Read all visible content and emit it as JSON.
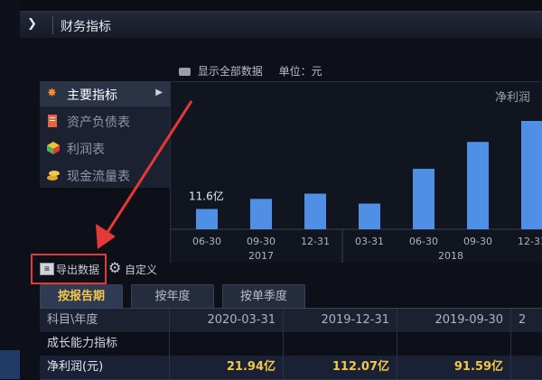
{
  "window": {
    "title": "财务指标"
  },
  "toolbar": {
    "show_all_label": "显示全部数据",
    "unit_label": "单位：元"
  },
  "menu": {
    "items": [
      {
        "label": "主要指标",
        "active": true
      },
      {
        "label": "资产负债表",
        "active": false
      },
      {
        "label": "利润表",
        "active": false
      },
      {
        "label": "现金流量表",
        "active": false
      }
    ]
  },
  "chart_data": {
    "type": "bar",
    "title": "净利润",
    "categories": [
      "06-30",
      "09-30",
      "12-31",
      "03-31",
      "06-30",
      "09-30",
      "12-31"
    ],
    "year_labels": [
      "2017",
      "2018"
    ],
    "values": [
      11.6,
      17.4,
      20.4,
      14.7,
      34.6,
      50.0,
      62.0
    ],
    "annotation": "11.6亿",
    "series_color": "#4f8fe6"
  },
  "actions": {
    "export_label": "导出数据",
    "custom_label": "自定义"
  },
  "tabs": [
    {
      "label": "按报告期",
      "active": true
    },
    {
      "label": "按年度",
      "active": false
    },
    {
      "label": "按单季度",
      "active": false
    }
  ],
  "table": {
    "header": [
      "科目\\年度",
      "2020-03-31",
      "2019-12-31",
      "2019-09-30",
      "2"
    ],
    "section": "成长能力指标",
    "rows": [
      {
        "label": "净利润(元)",
        "values": [
          "21.94亿",
          "112.07亿",
          "91.59亿"
        ]
      }
    ]
  }
}
